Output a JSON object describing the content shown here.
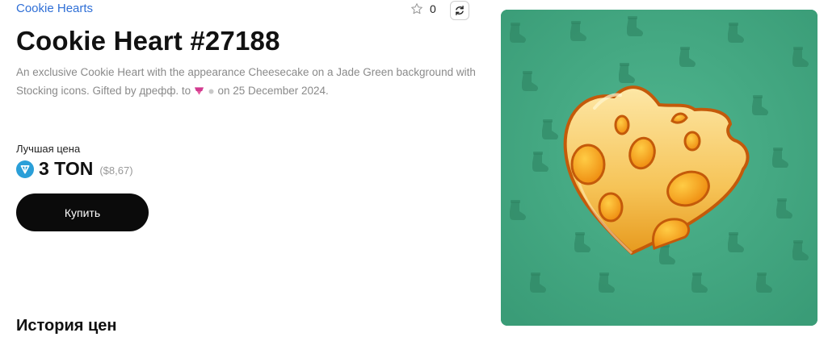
{
  "header": {
    "collection_name": "Cookie Hearts",
    "favorite_count": "0"
  },
  "item": {
    "title": "Cookie Heart #27188",
    "description_part1": "An exclusive Cookie Heart with the appearance Cheesecake on a Jade Green background with Stocking icons. Gifted by дрефф. to ",
    "description_part2": " on 25 December 2024.",
    "art": {
      "background_color": "#3ea47e",
      "pattern_icon": "stocking-icon",
      "subject_icon": "cheesecake-cookie-heart"
    }
  },
  "pricing": {
    "label": "Лучшая цена",
    "value": "3 TON",
    "usd": "($8,67)",
    "currency_color": "#2a9fd8"
  },
  "actions": {
    "buy_label": "Купить"
  },
  "sections": {
    "history_title": "История цен"
  }
}
